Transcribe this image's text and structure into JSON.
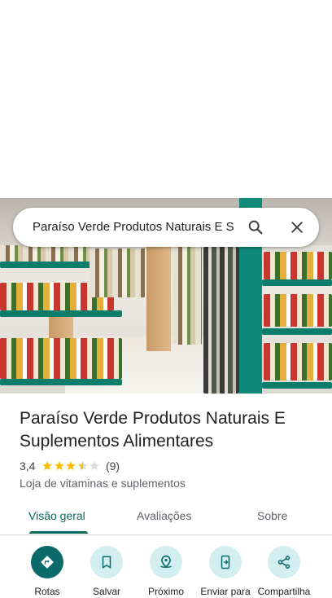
{
  "search": {
    "query": "Paraíso Verde Produtos Naturais E S",
    "search_icon": "search-icon",
    "clear_icon": "close-icon"
  },
  "place": {
    "name": "Paraíso Verde Produtos Naturais E Suplementos Alimentares",
    "rating": "3,4",
    "rating_value": 3.4,
    "review_count": "(9)",
    "category": "Loja de vitaminas e suplementos"
  },
  "tabs": [
    {
      "label": "Visão geral",
      "active": true
    },
    {
      "label": "Avaliações",
      "active": false
    },
    {
      "label": "Sobre",
      "active": false
    }
  ],
  "actions": [
    {
      "label": "Rotas",
      "icon": "directions-icon"
    },
    {
      "label": "Salvar",
      "icon": "bookmark-icon"
    },
    {
      "label": "Próximo",
      "icon": "nearby-icon"
    },
    {
      "label": "Enviar para",
      "icon": "send-to-phone-icon"
    },
    {
      "label": "Compartilha",
      "icon": "share-icon"
    }
  ],
  "colors": {
    "accent": "#0b6b5e",
    "action_bg": "#d3eef0",
    "primary_action_bg": "#0b6b6b",
    "star": "#fbbc04"
  }
}
